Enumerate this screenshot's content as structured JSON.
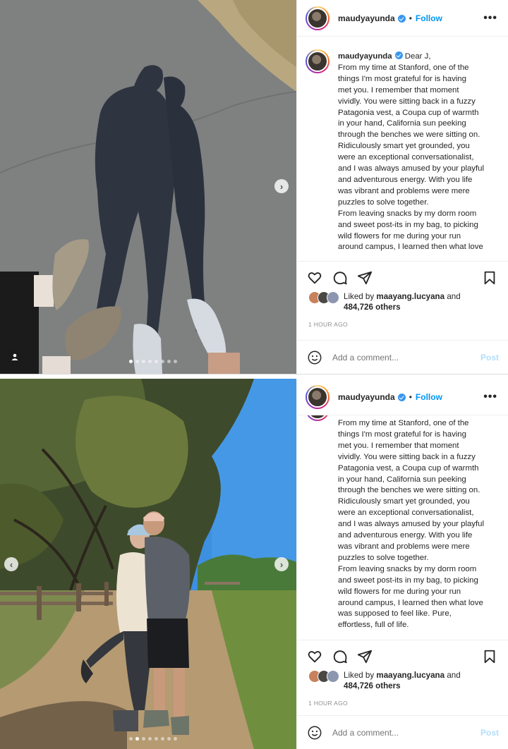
{
  "posts": [
    {
      "username": "maudyayunda",
      "follow_label": "Follow",
      "separator": "•",
      "more_label": "•••",
      "caption_first": "Dear J,",
      "caption_body": "From my time at Stanford, one of the\nthings I'm most grateful for is having\nmet you. I remember that moment\nvividly. You were sitting back in a fuzzy\nPatagonia vest, a Coupa cup of warmth\nin your hand, California sun peeking\nthrough the benches we were sitting on.\nRidiculously smart yet grounded, you\nwere an exceptional conversationalist,\nand I was always amused by your playful\nand adventurous energy. With you life\nwas vibrant and problems were mere\npuzzles to solve together.\nFrom leaving snacks by my dorm room\nand sweet post-its in my bag, to picking\nwild flowers for me during your run\naround campus, I learned then what love",
      "liked_by_prefix": "Liked by",
      "liked_by_user": "maayang.lucyana",
      "liked_by_and": "and",
      "liked_count": "484,726 others",
      "time": "1 HOUR AGO",
      "comment_placeholder": "Add a comment...",
      "post_label": "Post",
      "carousel_next": "›",
      "carousel_prev": "‹"
    },
    {
      "username": "maudyayunda",
      "follow_label": "Follow",
      "separator": "•",
      "more_label": "•••",
      "caption_body": "From my time at Stanford, one of the\nthings I'm most grateful for is having\nmet you. I remember that moment\nvividly. You were sitting back in a fuzzy\nPatagonia vest, a Coupa cup of warmth\nin your hand, California sun peeking\nthrough the benches we were sitting on.\nRidiculously smart yet grounded, you\nwere an exceptional conversationalist,\nand I was always amused by your playful\nand adventurous energy. With you life\nwas vibrant and problems were mere\npuzzles to solve together.\nFrom leaving snacks by my dorm room\nand sweet post-its in my bag, to picking\nwild flowers for me during your run\naround campus, I learned then what love\nwas supposed to feel like. Pure,\neffortless, full of life.",
      "liked_by_prefix": "Liked by",
      "liked_by_user": "maayang.lucyana",
      "liked_by_and": "and",
      "liked_count": "484,726 others",
      "time": "1 HOUR AGO",
      "comment_placeholder": "Add a comment...",
      "post_label": "Post",
      "carousel_next": "›",
      "carousel_prev": "‹"
    }
  ],
  "colors": {
    "link_blue": "#0095f6",
    "post_disabled": "#b2dffc",
    "verified": "#3897f0",
    "muted": "#8e8e8e",
    "border": "#efefef"
  },
  "icons": [
    "heart-icon",
    "comment-icon",
    "share-icon",
    "bookmark-icon",
    "emoji-icon",
    "verified-icon",
    "more-icon",
    "user-tag-icon"
  ]
}
